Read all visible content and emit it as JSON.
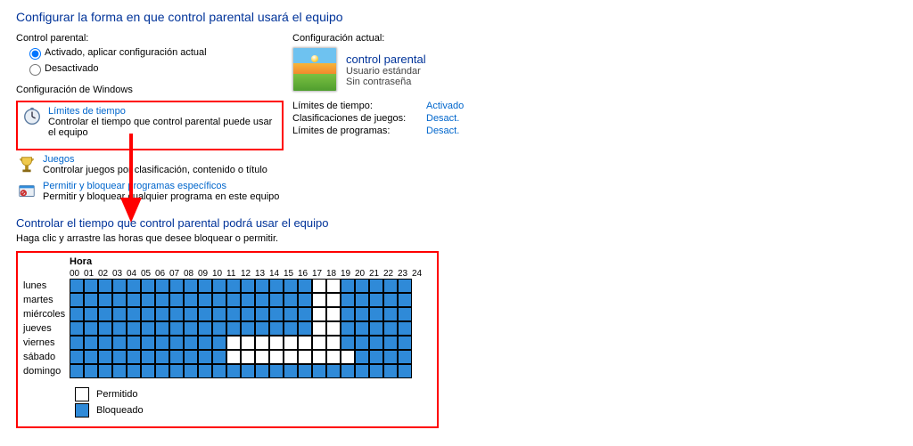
{
  "header1": "Configurar la forma en que control parental usará el equipo",
  "left": {
    "label": "Control parental:",
    "radio_on": "Activado, aplicar configuración actual",
    "radio_off": "Desactivado",
    "sub": "Configuración de Windows",
    "time": {
      "title": "Límites de tiempo",
      "desc": "Controlar el tiempo que control parental puede usar el equipo"
    },
    "games": {
      "title": "Juegos",
      "desc": "Controlar juegos por clasificación, contenido o título"
    },
    "programs": {
      "title": "Permitir y bloquear programas específicos",
      "desc": "Permitir y bloquear cualquier programa en este equipo"
    }
  },
  "right": {
    "label": "Configuración actual:",
    "user": {
      "name": "control parental",
      "role": "Usuario estándar",
      "pwd": "Sin contraseña"
    },
    "status": {
      "time_k": "Límites de tiempo:",
      "time_v": "Activado",
      "games_k": "Clasificaciones de juegos:",
      "games_v": "Desact.",
      "prog_k": "Límites de programas:",
      "prog_v": "Desact."
    }
  },
  "section2": {
    "header": "Controlar el tiempo que control parental podrá usar el equipo",
    "instr": "Haga clic y arrastre las horas que desee bloquear o permitir.",
    "hora": "Hora",
    "hours": [
      "00",
      "01",
      "02",
      "03",
      "04",
      "05",
      "06",
      "07",
      "08",
      "09",
      "10",
      "11",
      "12",
      "13",
      "14",
      "15",
      "16",
      "17",
      "18",
      "19",
      "20",
      "21",
      "22",
      "23",
      "24"
    ],
    "days": [
      "lunes",
      "martes",
      "miércoles",
      "jueves",
      "viernes",
      "sábado",
      "domingo"
    ],
    "legend_allowed": "Permitido",
    "legend_blocked": "Bloqueado"
  },
  "chart_data": {
    "type": "heatmap",
    "title": "Hora",
    "x": [
      0,
      1,
      2,
      3,
      4,
      5,
      6,
      7,
      8,
      9,
      10,
      11,
      12,
      13,
      14,
      15,
      16,
      17,
      18,
      19,
      20,
      21,
      22,
      23
    ],
    "y": [
      "lunes",
      "martes",
      "miércoles",
      "jueves",
      "viernes",
      "sábado",
      "domingo"
    ],
    "legend": {
      "0": "Permitido",
      "1": "Bloqueado"
    },
    "values": [
      [
        1,
        1,
        1,
        1,
        1,
        1,
        1,
        1,
        1,
        1,
        1,
        1,
        1,
        1,
        1,
        1,
        1,
        0,
        0,
        1,
        1,
        1,
        1,
        1
      ],
      [
        1,
        1,
        1,
        1,
        1,
        1,
        1,
        1,
        1,
        1,
        1,
        1,
        1,
        1,
        1,
        1,
        1,
        0,
        0,
        1,
        1,
        1,
        1,
        1
      ],
      [
        1,
        1,
        1,
        1,
        1,
        1,
        1,
        1,
        1,
        1,
        1,
        1,
        1,
        1,
        1,
        1,
        1,
        0,
        0,
        1,
        1,
        1,
        1,
        1
      ],
      [
        1,
        1,
        1,
        1,
        1,
        1,
        1,
        1,
        1,
        1,
        1,
        1,
        1,
        1,
        1,
        1,
        1,
        0,
        0,
        1,
        1,
        1,
        1,
        1
      ],
      [
        1,
        1,
        1,
        1,
        1,
        1,
        1,
        1,
        1,
        1,
        1,
        0,
        0,
        0,
        0,
        0,
        0,
        0,
        0,
        1,
        1,
        1,
        1,
        1
      ],
      [
        1,
        1,
        1,
        1,
        1,
        1,
        1,
        1,
        1,
        1,
        1,
        0,
        0,
        0,
        0,
        0,
        0,
        0,
        0,
        0,
        1,
        1,
        1,
        1
      ],
      [
        1,
        1,
        1,
        1,
        1,
        1,
        1,
        1,
        1,
        1,
        1,
        1,
        1,
        1,
        1,
        1,
        1,
        1,
        1,
        1,
        1,
        1,
        1,
        1
      ]
    ]
  }
}
